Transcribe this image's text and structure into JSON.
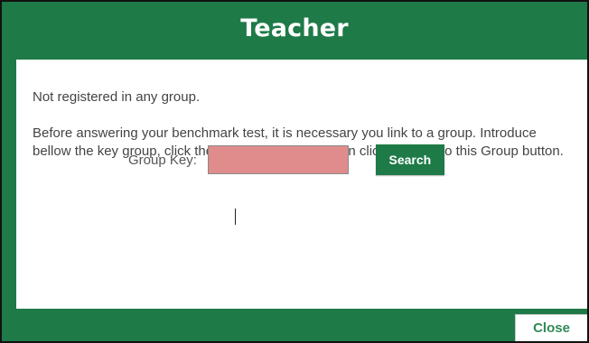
{
  "dialog": {
    "title": "Teacher",
    "status_text": "Not registered in any group.",
    "instructions": "Before answering your benchmark test, it is necessary you link to a group. Introduce bellow the key group, click the search button and then click the Link to this Group button.",
    "group_key": {
      "label": "Group Key:",
      "value": "",
      "placeholder": ""
    },
    "search_label": "Search",
    "close_label": "Close"
  },
  "colors": {
    "brand_green": "#1e7a47",
    "input_error_bg": "#e08c8c",
    "text_gray": "#444444"
  }
}
